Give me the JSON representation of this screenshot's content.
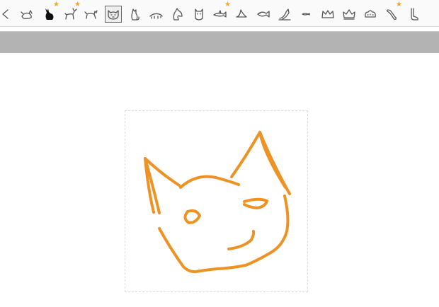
{
  "toolbar": {
    "icons": [
      {
        "name": "arrow-left-icon"
      },
      {
        "name": "fish-cat-icon"
      },
      {
        "name": "black-cat-icon",
        "starred": true
      },
      {
        "name": "deer-icon",
        "starred": true
      },
      {
        "name": "walking-cat-icon"
      },
      {
        "name": "cat-face-icon",
        "selected": true
      },
      {
        "name": "sitting-cat-icon"
      },
      {
        "name": "crawling-animal-icon"
      },
      {
        "name": "horse-head-icon"
      },
      {
        "name": "owl-icon"
      },
      {
        "name": "shark-icon",
        "starred": true
      },
      {
        "name": "fin-icon"
      },
      {
        "name": "fish-icon"
      },
      {
        "name": "jumping-fish-icon"
      },
      {
        "name": "small-fish-icon"
      },
      {
        "name": "crown-icon"
      },
      {
        "name": "royal-crown-icon"
      },
      {
        "name": "ornate-crown-icon"
      },
      {
        "name": "bone-icon",
        "starred": true
      },
      {
        "name": "foot-icon"
      }
    ]
  },
  "drawing": {
    "stroke_color": "#ee9223"
  }
}
